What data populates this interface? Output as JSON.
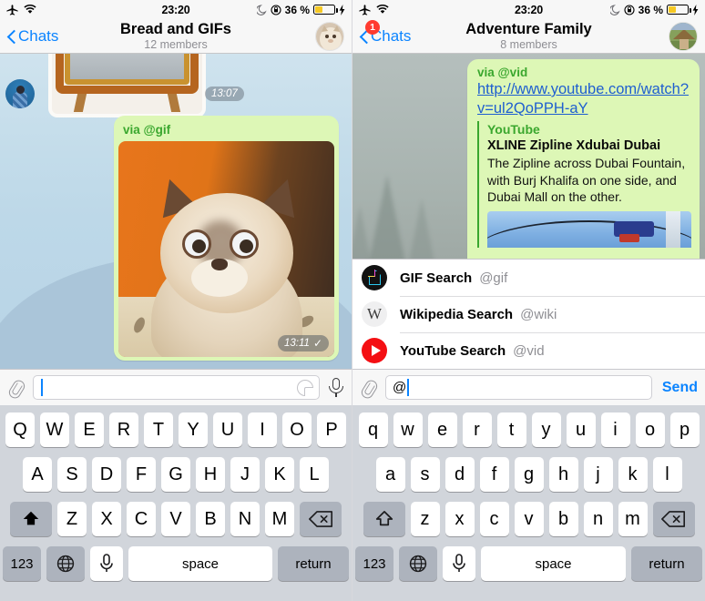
{
  "panels": [
    {
      "id": "left",
      "status": {
        "time": "23:20",
        "airplane_icon": "airplane-mode-icon",
        "wifi_icon": "wifi-icon",
        "moon_icon": "do-not-disturb-icon",
        "lock_icon": "rotation-lock-icon",
        "battery_percent": "36 %",
        "battery_level": 36,
        "charging_icon": "charging-bolt-icon"
      },
      "nav": {
        "back_label": "Chats",
        "badge": "",
        "title": "Bread and GIFs",
        "subtitle": "12 members",
        "avatar_name": "group-avatar-cat"
      },
      "chat": {
        "wallpaper": "winter-sky",
        "sticker_time": "13:07",
        "bubble": {
          "via": "via @gif",
          "media_kind": "gif-cat",
          "time": "13:11",
          "status_tick": "✓"
        }
      },
      "input": {
        "attach_icon": "paperclip-icon",
        "value": "",
        "placeholder": "",
        "sticker_icon": "sticker-icon",
        "mic_icon": "microphone-icon"
      },
      "keyboard": {
        "case": "upper",
        "row1": [
          "Q",
          "W",
          "E",
          "R",
          "T",
          "Y",
          "U",
          "I",
          "O",
          "P"
        ],
        "row2": [
          "A",
          "S",
          "D",
          "F",
          "G",
          "H",
          "J",
          "K",
          "L"
        ],
        "row3": [
          "Z",
          "X",
          "C",
          "V",
          "B",
          "N",
          "M"
        ],
        "shift_icon": "shift-filled-icon",
        "backspace_icon": "backspace-icon",
        "numbers_label": "123",
        "globe_icon": "globe-icon",
        "mic_icon": "microphone-icon",
        "space_label": "space",
        "return_label": "return"
      }
    },
    {
      "id": "right",
      "status": {
        "time": "23:20",
        "airplane_icon": "airplane-mode-icon",
        "wifi_icon": "wifi-icon",
        "moon_icon": "do-not-disturb-icon",
        "lock_icon": "rotation-lock-icon",
        "battery_percent": "36 %",
        "battery_level": 36,
        "charging_icon": "charging-bolt-icon"
      },
      "nav": {
        "back_label": "Chats",
        "badge": "1",
        "title": "Adventure Family",
        "subtitle": "8 members",
        "avatar_name": "group-avatar-hut"
      },
      "chat": {
        "wallpaper": "foggy-forest",
        "bubble": {
          "via": "via @vid",
          "url": "http://www.youtube.com/watch?v=ul2QoPPH-aY",
          "preview_site": "YouTube",
          "preview_title": "XLINE Zipline Xdubai Dubai",
          "preview_desc": "The Zipline across Dubai Fountain, with Burj Khalifa on one side, and Dubai Mall on the other.",
          "preview_image_name": "zipline-thumbnail"
        }
      },
      "suggestions": [
        {
          "icon": "gif-search-icon",
          "name": "GIF Search",
          "handle": "@gif"
        },
        {
          "icon": "wikipedia-icon",
          "name": "Wikipedia Search",
          "handle": "@wiki",
          "glyph": "W"
        },
        {
          "icon": "youtube-icon",
          "name": "YouTube Search",
          "handle": "@vid"
        }
      ],
      "input": {
        "attach_icon": "paperclip-icon",
        "value": "@",
        "placeholder": "",
        "send_label": "Send"
      },
      "keyboard": {
        "case": "lower",
        "row1": [
          "q",
          "w",
          "e",
          "r",
          "t",
          "y",
          "u",
          "i",
          "o",
          "p"
        ],
        "row2": [
          "a",
          "s",
          "d",
          "f",
          "g",
          "h",
          "j",
          "k",
          "l"
        ],
        "row3": [
          "z",
          "x",
          "c",
          "v",
          "b",
          "n",
          "m"
        ],
        "shift_icon": "shift-outline-icon",
        "backspace_icon": "backspace-icon",
        "numbers_label": "123",
        "globe_icon": "globe-icon",
        "mic_icon": "microphone-icon",
        "space_label": "space",
        "return_label": "return"
      }
    }
  ],
  "colors": {
    "accent_blue": "#0b84ff",
    "bubble_green": "#ddf7b6",
    "via_green": "#3aa72e",
    "link_blue": "#1f5fd0",
    "badge_red": "#ff3b30",
    "battery_yellow": "#f6c823",
    "keyboard_bg": "#d1d5db",
    "key_dark": "#adb3bd"
  }
}
